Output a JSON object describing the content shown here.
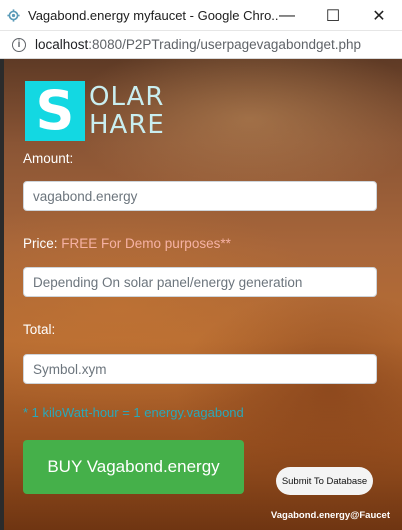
{
  "window": {
    "title": "Vagabond.energy myfaucet - Google Chro...",
    "controls": {
      "minimize": "—",
      "maximize": "☐",
      "close": "✕"
    }
  },
  "address": {
    "host": "localhost",
    "path": ":8080/P2PTrading/userpagevagabondget.php"
  },
  "logo": {
    "letter": "S",
    "line1": "OLAR",
    "line2": "HARE"
  },
  "form": {
    "amount_label": "Amount:",
    "amount_placeholder": "vagabond.energy",
    "price_label": "Price:",
    "price_note": "FREE For Demo purposes**",
    "price_placeholder": "Depending On solar panel/energy generation",
    "total_label": "Total:",
    "total_placeholder": "Symbol.xym",
    "conversion_note": "* 1 kiloWatt-hour = 1 energy.vagabond"
  },
  "buttons": {
    "buy_label": "BUY Vagabond.energy",
    "submit_label": "Submit To Database"
  },
  "footer": {
    "credit": "Vagabond.energy@Faucet"
  },
  "colors": {
    "logo_accent": "#13d8e2",
    "buy_button": "#45b04a",
    "note_text": "#2aa8b9",
    "price_note_text": "#f6b2a4"
  }
}
